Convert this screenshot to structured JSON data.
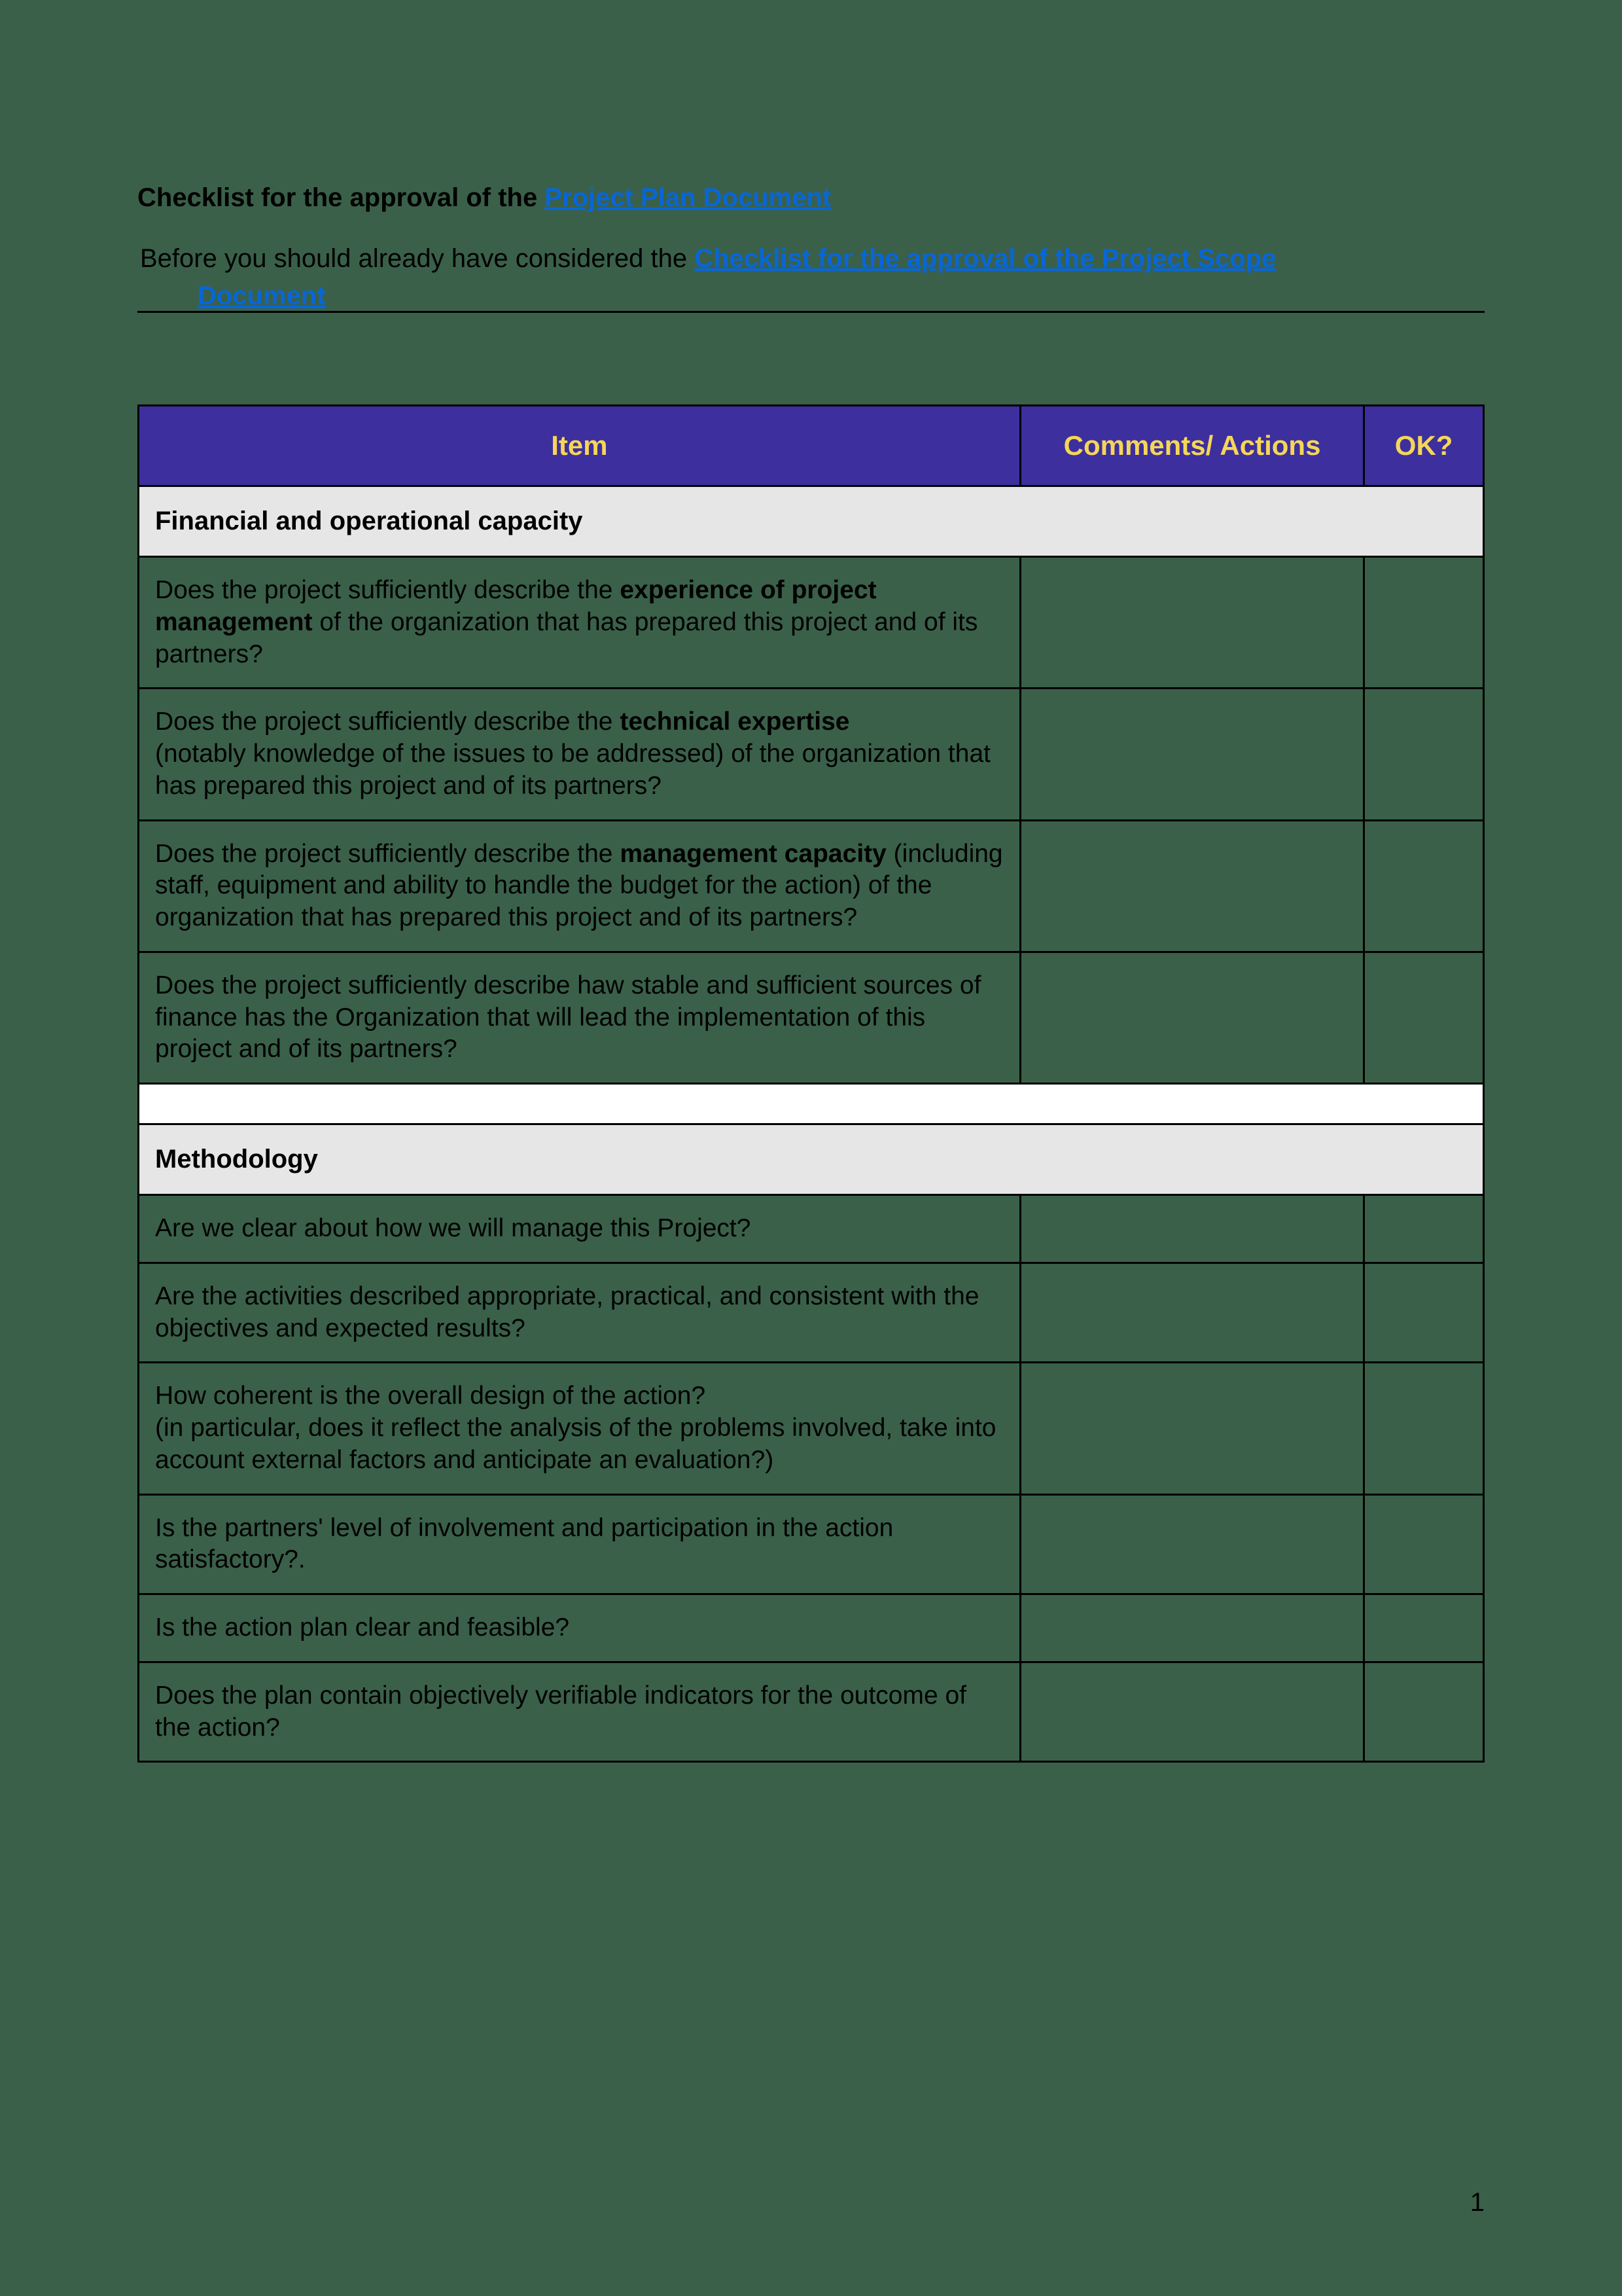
{
  "title_prefix": "Checklist for the approval of the ",
  "title_link": "Project Plan Document",
  "intro_text": "Before you should already have considered the  ",
  "intro_link": "Checklist for the approval of the Project Scope",
  "intro_link_continue": "Document",
  "headers": {
    "item": "Item",
    "comments": "Comments/ Actions",
    "ok": "OK?"
  },
  "sections": [
    {
      "title": "Financial and operational capacity",
      "rows": [
        {
          "pre": "Does the project sufficiently describe the ",
          "bold": "experience of project management",
          "post": " of the organization that has prepared this project and of  its partners?"
        },
        {
          "pre": "Does the project sufficiently describe the ",
          "bold": "technical expertise",
          "post_lines": "(notably knowledge of the issues to be addressed) of the organization that has prepared this project and of  its partners?"
        },
        {
          "pre": "Does the project sufficiently describe the ",
          "bold": "management capacity",
          "post": " (including staff, equipment and ability to handle the budget for the action) of the organization that has prepared this project and of  its partners?"
        },
        {
          "plain": "Does the project sufficiently describe haw stable and sufficient sources of finance has the Organization that will lead the implementation of this project and of  its partners?"
        }
      ]
    },
    {
      "title": "Methodology",
      "rows": [
        {
          "plain": "Are we clear about how we will manage this Project?"
        },
        {
          "plain": "Are the activities described appropriate, practical, and consistent with the objectives and expected results?"
        },
        {
          "plain_lines": [
            "How coherent is the overall design of the action?",
            "(in particular, does it reflect the analysis of the problems involved, take into account external factors and anticipate an evaluation?)"
          ]
        },
        {
          "plain": "Is the partners' level of involvement and participation in the action satisfactory?."
        },
        {
          "plain": "Is the action plan clear and feasible?"
        },
        {
          "plain": "Does the plan contain objectively verifiable indicators for the outcome of the action?"
        }
      ]
    }
  ],
  "page_number": "1"
}
